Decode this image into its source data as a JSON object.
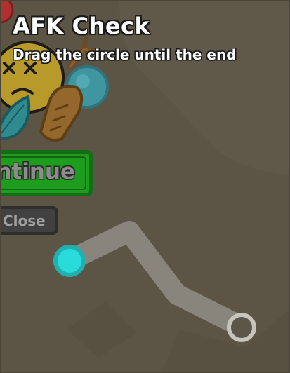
{
  "dialog": {
    "title": "AFK Check",
    "subtitle": "Drag the circle until the end"
  },
  "buttons": {
    "continue_label": "ntinue",
    "close_label": "Close"
  },
  "colors": {
    "background": "#5c5546",
    "continue_button": "#1e9c1e",
    "drag_handle": "#2adbdb",
    "path": "#8a857c"
  },
  "icons": [
    "red-ball-icon",
    "dizzy-face-icon",
    "teal-bubble-icon",
    "leaf-icon",
    "cookie-icon",
    "antenna-icon"
  ]
}
